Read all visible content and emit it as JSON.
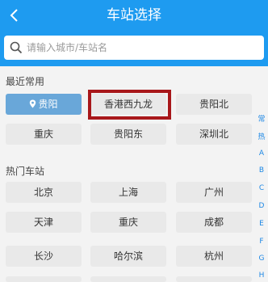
{
  "header": {
    "title": "车站选择",
    "back_icon": "chevron-left-icon"
  },
  "search": {
    "placeholder": "请输入城市/车站名",
    "value": "",
    "icon": "search-icon"
  },
  "recent": {
    "label": "最近常用",
    "stations": [
      "贵阳",
      "香港西九龙",
      "贵阳北",
      "重庆",
      "贵阳东",
      "深圳北"
    ],
    "active_index": 0,
    "highlighted": "香港西九龙"
  },
  "hot": {
    "label": "热门车站",
    "stations": [
      "北京",
      "上海",
      "广州",
      "天津",
      "重庆",
      "成都",
      "长沙",
      "哈尔滨",
      "杭州"
    ]
  },
  "index_bar": [
    "常",
    "热",
    "A",
    "B",
    "C",
    "D",
    "E",
    "F",
    "G",
    "H"
  ],
  "colors": {
    "header": "#1e9bf0",
    "active": "#69a7d9",
    "highlight": "#a8171a",
    "index": "#1e88e5"
  }
}
